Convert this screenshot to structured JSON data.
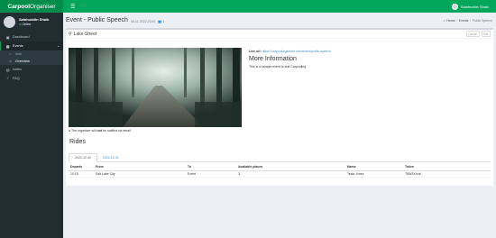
{
  "app": {
    "brand_bold": "Carpool",
    "brand_rest": "Organiser"
  },
  "topbar": {
    "menu_icon": "bars-icon",
    "user_name": "Salahuddin Shaik"
  },
  "sidebar": {
    "user": {
      "name": "Salahuddin Shaik",
      "status": "Online"
    },
    "items": [
      {
        "label": "Dashboard",
        "icon": "dashboard-icon"
      },
      {
        "label": "Events",
        "icon": "calendar-icon",
        "caret": "‹"
      },
      {
        "label": "Add",
        "icon": "circle-icon"
      },
      {
        "label": "Overview",
        "icon": "circle-icon"
      },
      {
        "label": "Notes",
        "icon": "book-icon"
      },
      {
        "label": "FAQ",
        "icon": "question-icon"
      }
    ]
  },
  "header": {
    "title": "Event - Public Speech",
    "subtitle": "30-11-2022 21:00",
    "user_count": "1"
  },
  "breadcrumb": [
    "Home",
    "Events",
    "Public Speech"
  ],
  "box": {
    "title": "Lake Street",
    "tools": [
      "Cancel",
      "Edit"
    ]
  },
  "photo": {
    "alt": "Forest road"
  },
  "note": {
    "prefix": "The organiser will ",
    "emph": "not",
    "suffix": " be notified via email."
  },
  "info": {
    "live_label": "Live url:",
    "live_url": "https://carpoolorganiser.com/event/public-speech",
    "more_title": "More Information",
    "description": "This is a sample event to test Carpooling"
  },
  "rides": {
    "title": "Rides",
    "tabs": [
      "2022-12-30",
      "2022-12-31"
    ],
    "columns": [
      "Departs",
      "From",
      "To",
      "Available places",
      "Name",
      "Token"
    ],
    "rows": [
      [
        "10:15",
        "Salt Lake City",
        "Event",
        "3",
        "Tesla Jones",
        "T6W3XIuuf"
      ]
    ]
  },
  "colors": {
    "accent": "#00a65a",
    "accent_dark": "#008d4c",
    "sidebar": "#222d32",
    "link": "#3c8dbc"
  }
}
